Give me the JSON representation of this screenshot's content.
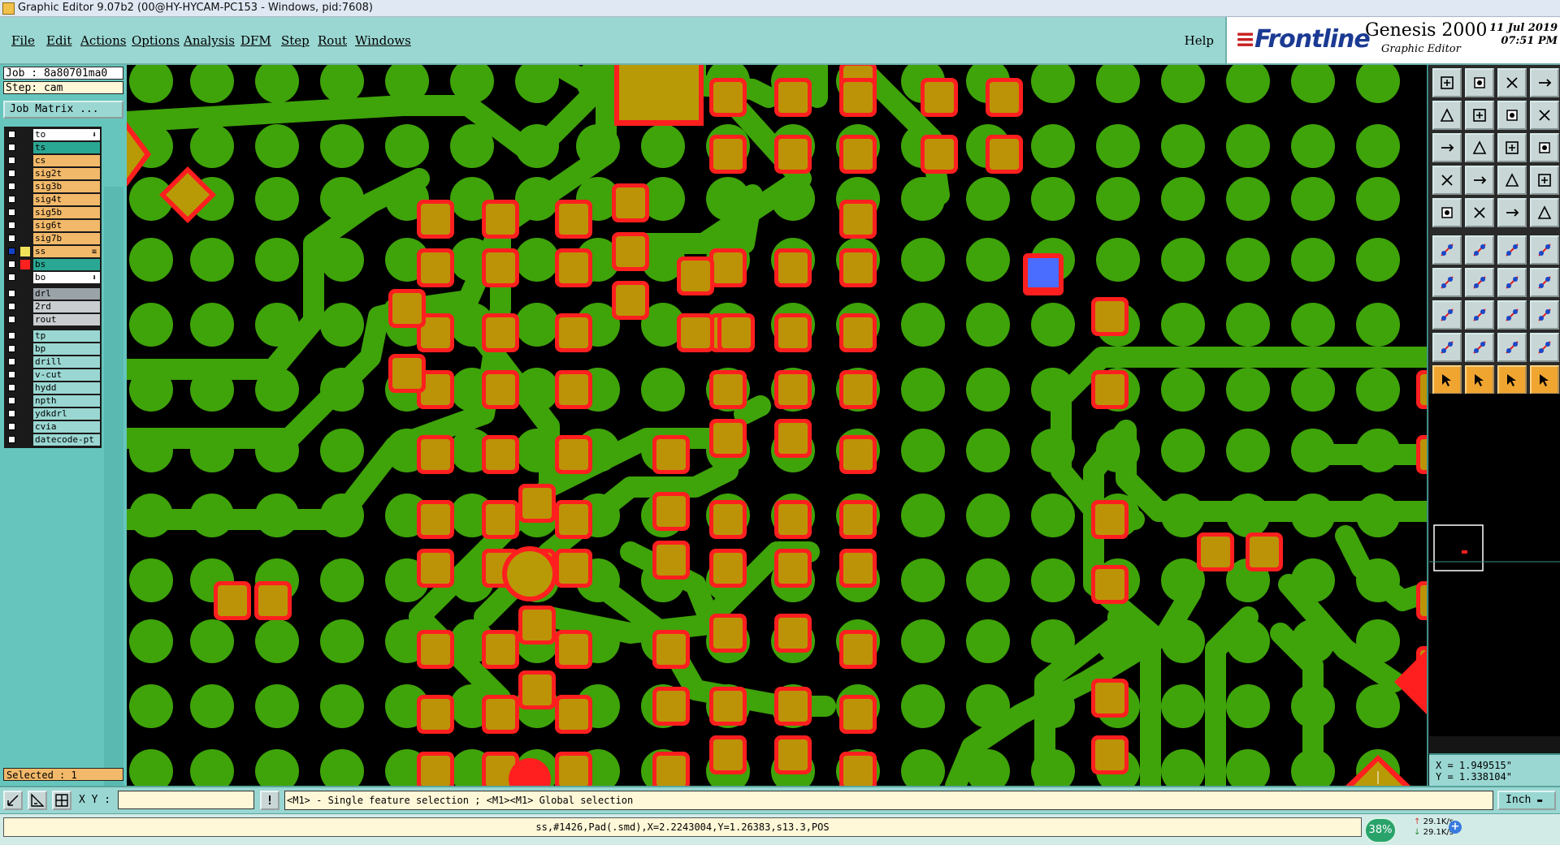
{
  "window": {
    "title": "Graphic Editor 9.07b2 (00@HY-HYCAM-PC153 - Windows, pid:7608)"
  },
  "menu": {
    "items": [
      "File",
      "Edit",
      "Actions",
      "Options",
      "Analysis",
      "DFM",
      "Step",
      "Rout",
      "Windows"
    ],
    "help": "Help"
  },
  "logo": {
    "brand": "Frontline",
    "product": "Genesis 2000",
    "subtitle": "Graphic Editor",
    "date": "11 Jul 2019",
    "time": "07:51 PM"
  },
  "job": {
    "job_line": "Job : 8a80701ma0",
    "step_line": "Step: cam",
    "matrix_button": "Job Matrix ..."
  },
  "layers": {
    "board": [
      {
        "name": "to",
        "color": "#ffffff",
        "mark": "⬇"
      },
      {
        "name": "ts",
        "color": "#2aa893",
        "mark": ""
      },
      {
        "name": "cs",
        "color": "#f2b96a",
        "mark": ""
      },
      {
        "name": "sig2t",
        "color": "#f2b96a",
        "mark": ""
      },
      {
        "name": "sig3b",
        "color": "#f2b96a",
        "mark": ""
      },
      {
        "name": "sig4t",
        "color": "#f2b96a",
        "mark": ""
      },
      {
        "name": "sig5b",
        "color": "#f2b96a",
        "mark": ""
      },
      {
        "name": "sig6t",
        "color": "#f2b96a",
        "mark": ""
      },
      {
        "name": "sig7b",
        "color": "#f2b96a",
        "mark": ""
      },
      {
        "name": "ss",
        "color": "#f2b96a",
        "mark": "≡"
      },
      {
        "name": "bs",
        "color": "#2aa893",
        "mark": ""
      },
      {
        "name": "bo",
        "color": "#ffffff",
        "mark": "⬇"
      }
    ],
    "drill": [
      {
        "name": "drl",
        "color": "#9aa3a8"
      },
      {
        "name": "2rd",
        "color": "#c9cdd0"
      },
      {
        "name": "rout",
        "color": "#c9cdd0"
      }
    ],
    "misc": [
      "tp",
      "bp",
      "drill",
      "v-cut",
      "hydd",
      "npth",
      "ydkdrl",
      "cvia",
      "datecode-pt"
    ]
  },
  "selected": "Selected : 1",
  "coords": {
    "x": "X =  1.949515\"",
    "y": "Y =  1.338104\""
  },
  "cmd": {
    "xy_label": "X Y :",
    "xy_value": "",
    "hint": "<M1> - Single feature selection ; <M1><M1> Global selection",
    "units": "Inch"
  },
  "status": {
    "feature_info": "ss,#1426,Pad(.smd),X=2.2243004,Y=1.26383,s13.3,POS",
    "net_percent": "38%",
    "upload": "29.1K/s",
    "download": "29.1K/s"
  },
  "colors": {
    "trace": "#3fa30a",
    "pad_highlight": "#ff1f1f",
    "pad_fill": "#b89a06",
    "selected_pad": "#4a6cff"
  }
}
